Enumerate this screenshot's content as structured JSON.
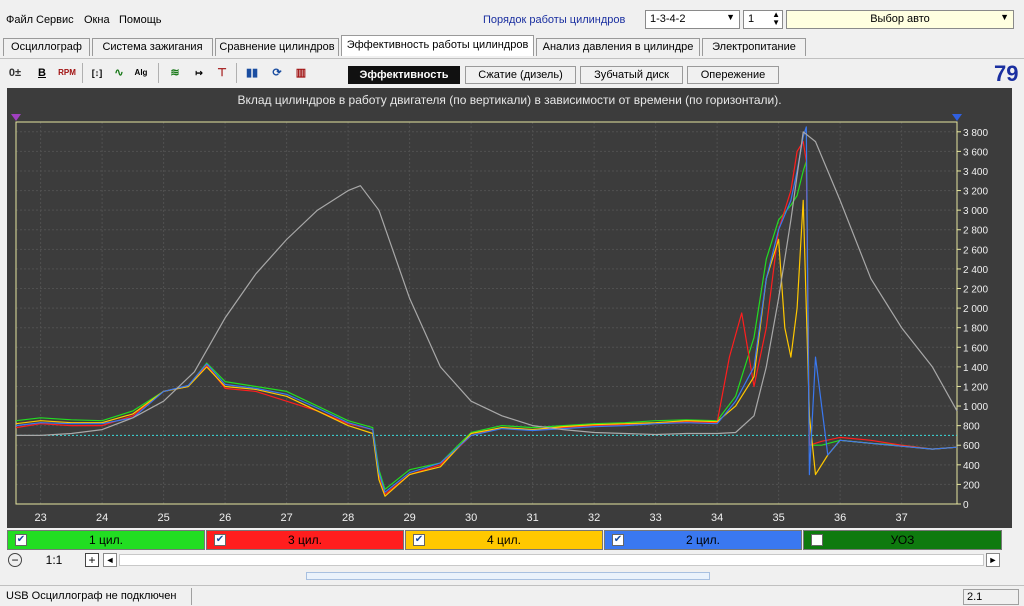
{
  "menu": [
    "Файл",
    "Сервис",
    "Окна",
    "Помощь"
  ],
  "cylinder_order": {
    "label": "Порядок работы цилиндров",
    "value": "1-3-4-2",
    "spin": "1"
  },
  "car_select": "Выбор авто",
  "tabs": [
    "Осциллограф",
    "Система зажигания",
    "Сравнение цилиндров",
    "Эффективность работы цилиндров",
    "Анализ давления в цилиндре",
    "Электропитание"
  ],
  "active_tab": 3,
  "subtabs": [
    "Эффективность",
    "Сжатие (дизель)",
    "Зубчатый диск",
    "Опережение"
  ],
  "big_number": "79",
  "toolbar_icons": [
    "zoom-icon",
    "bold-b-icon",
    "rpm-icon",
    "scale-icon",
    "line-icon",
    "alg-icon",
    "filter-icon",
    "count-icon",
    "marker-icon",
    "bars-icon",
    "sync-icon",
    "stats-icon"
  ],
  "legend": [
    {
      "label": "1 цил.",
      "color": "#22dd22",
      "checked": true
    },
    {
      "label": "3 цил.",
      "color": "#ff1e1e",
      "checked": true
    },
    {
      "label": "4 цил.",
      "color": "#ffc800",
      "checked": true
    },
    {
      "label": "2 цил.",
      "color": "#3a78f0",
      "checked": true
    },
    {
      "label": "УОЗ",
      "color": "#0e7a0e",
      "checked": false
    }
  ],
  "zoom_label": "1:1",
  "status": "USB Осциллограф не подключен",
  "status_right": "2.1",
  "chart_data": {
    "type": "line",
    "title": "Вклад цилиндров в работу двигателя (по вертикали) в зависимости от времени (по горизонтали).",
    "xlim": [
      22.6,
      37.9
    ],
    "ylim": [
      0,
      3900
    ],
    "xticks": [
      23,
      24,
      25,
      26,
      27,
      28,
      29,
      30,
      31,
      32,
      33,
      34,
      35,
      36,
      37
    ],
    "yticks": [
      0,
      200,
      400,
      600,
      800,
      1000,
      1200,
      1400,
      1600,
      1800,
      2000,
      2200,
      2400,
      2600,
      2800,
      3000,
      3200,
      3400,
      3600,
      3800
    ],
    "threshold": 700,
    "series": [
      {
        "name": "1 цил.",
        "color": "#22dd22",
        "x": [
          22.6,
          23,
          23.5,
          24,
          24.5,
          25,
          25.4,
          25.7,
          26,
          26.5,
          27,
          27.5,
          28,
          28.4,
          28.5,
          28.6,
          29,
          29.5,
          30,
          30.5,
          31,
          31.5,
          32,
          32.5,
          33,
          33.5,
          34,
          34.3,
          34.6,
          34.8,
          35,
          35.2,
          35.3,
          35.4,
          35.45,
          35.5,
          35.7,
          36,
          36.5,
          37,
          37.5,
          37.9
        ],
        "y": [
          850,
          880,
          860,
          850,
          950,
          1150,
          1200,
          1440,
          1250,
          1200,
          1150,
          1000,
          850,
          780,
          350,
          150,
          350,
          420,
          730,
          800,
          780,
          800,
          820,
          830,
          850,
          860,
          850,
          1100,
          1700,
          2500,
          2900,
          3050,
          3150,
          3400,
          3500,
          600,
          600,
          650,
          620,
          600,
          560,
          580
        ]
      },
      {
        "name": "3 цил.",
        "color": "#ff1e1e",
        "x": [
          22.6,
          23,
          23.5,
          24,
          24.5,
          25,
          25.4,
          25.7,
          26,
          26.5,
          27,
          27.5,
          28,
          28.4,
          28.5,
          28.6,
          29,
          29.5,
          30,
          30.5,
          31,
          31.5,
          32,
          32.5,
          33,
          33.5,
          34,
          34.2,
          34.4,
          34.6,
          34.8,
          35,
          35.2,
          35.3,
          35.4,
          35.45,
          35.5,
          35.7,
          36,
          36.5,
          37,
          37.5,
          37.9
        ],
        "y": [
          780,
          820,
          800,
          800,
          900,
          1150,
          1200,
          1420,
          1180,
          1150,
          1050,
          950,
          820,
          760,
          300,
          100,
          300,
          400,
          700,
          780,
          760,
          780,
          800,
          810,
          820,
          840,
          830,
          1500,
          1950,
          1200,
          1800,
          2800,
          3200,
          3600,
          3700,
          3500,
          600,
          640,
          680,
          650,
          600,
          560,
          580
        ]
      },
      {
        "name": "4 цил.",
        "color": "#ffc800",
        "x": [
          22.6,
          23,
          23.5,
          24,
          24.5,
          25,
          25.4,
          25.7,
          26,
          26.5,
          27,
          27.5,
          28,
          28.4,
          28.5,
          28.6,
          29,
          29.5,
          30,
          30.5,
          31,
          31.5,
          32,
          32.5,
          33,
          33.5,
          34,
          34.3,
          34.6,
          34.8,
          35,
          35.1,
          35.2,
          35.3,
          35.4,
          35.5,
          35.6,
          35.8,
          36,
          36.5,
          37,
          37.5,
          37.9
        ],
        "y": [
          820,
          850,
          830,
          830,
          920,
          1150,
          1200,
          1400,
          1200,
          1170,
          1100,
          950,
          800,
          720,
          250,
          80,
          300,
          380,
          720,
          780,
          760,
          790,
          810,
          820,
          830,
          850,
          840,
          1000,
          1300,
          2300,
          2700,
          1800,
          1500,
          2000,
          3100,
          900,
          300,
          500,
          650,
          620,
          590,
          560,
          580
        ]
      },
      {
        "name": "2 цил.",
        "color": "#3a78f0",
        "x": [
          22.6,
          23,
          23.5,
          24,
          24.5,
          25,
          25.4,
          25.7,
          26,
          26.5,
          27,
          27.5,
          28,
          28.4,
          28.5,
          28.6,
          29,
          29.5,
          30,
          30.5,
          31,
          31.5,
          32,
          32.5,
          33,
          33.5,
          34,
          34.3,
          34.6,
          34.8,
          35,
          35.2,
          35.3,
          35.4,
          35.45,
          35.5,
          35.6,
          35.8,
          36,
          36.5,
          37,
          37.5,
          37.9
        ],
        "y": [
          800,
          830,
          820,
          820,
          880,
          1150,
          1210,
          1430,
          1220,
          1180,
          1120,
          980,
          830,
          760,
          320,
          120,
          320,
          420,
          700,
          770,
          750,
          770,
          790,
          800,
          820,
          830,
          820,
          1050,
          1400,
          2300,
          2800,
          3100,
          3400,
          3750,
          3850,
          300,
          1500,
          500,
          650,
          620,
          590,
          560,
          580
        ]
      },
      {
        "name": "RPM",
        "color": "#a8a8a8",
        "x": [
          22.6,
          23,
          23.5,
          24,
          24.5,
          25,
          25.5,
          26,
          26.5,
          27,
          27.5,
          28,
          28.2,
          28.5,
          29,
          29.5,
          30,
          30.5,
          31,
          31.5,
          32,
          32.5,
          33,
          33.5,
          34,
          34.3,
          34.6,
          34.8,
          35,
          35.2,
          35.4,
          35.6,
          36,
          36.5,
          37,
          37.5,
          37.9
        ],
        "y": [
          700,
          700,
          720,
          760,
          880,
          1050,
          1350,
          1900,
          2350,
          2700,
          3000,
          3200,
          3250,
          3000,
          2100,
          1400,
          1050,
          900,
          800,
          760,
          730,
          720,
          710,
          720,
          720,
          730,
          900,
          1400,
          2100,
          2900,
          3800,
          3700,
          3100,
          2300,
          1800,
          1400,
          950
        ]
      }
    ]
  }
}
